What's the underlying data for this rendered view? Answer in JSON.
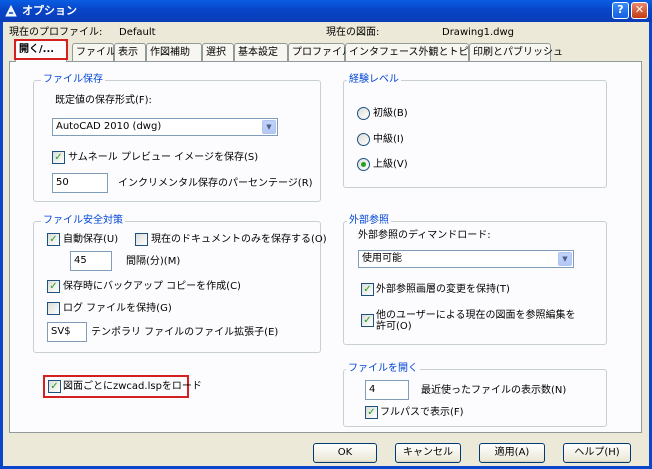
{
  "window": {
    "title": "オプション",
    "help_btn": "?",
    "close_btn": "✕"
  },
  "header": {
    "profile_label": "現在のプロファイル:",
    "profile_value": "Default",
    "drawing_label": "現在の図面:",
    "drawing_value": "Drawing1.dwg"
  },
  "tabs": [
    {
      "label": "開く/..."
    },
    {
      "label": "ファイル"
    },
    {
      "label": "表示"
    },
    {
      "label": "作図補助"
    },
    {
      "label": "選択"
    },
    {
      "label": "基本設定"
    },
    {
      "label": "プロファイル"
    },
    {
      "label": "インタフェース外観とトピック"
    },
    {
      "label": "印刷とパブリッシュ"
    }
  ],
  "file_save": {
    "title": "ファイル保存",
    "format_label": "既定値の保存形式(F):",
    "format_value": "AutoCAD 2010 (dwg)",
    "thumbnail_label": "サムネール プレビュー イメージを保存(S)",
    "thumbnail_checked": true,
    "incremental_value": "50",
    "incremental_label": "インクリメンタル保存のパーセンテージ(R)"
  },
  "file_safety": {
    "title": "ファイル安全対策",
    "autosave_label": "自動保存(U)",
    "autosave_checked": true,
    "current_doc_label": "現在のドキュメントのみを保存する(O)",
    "current_doc_checked": false,
    "interval_value": "45",
    "interval_label": "間隔(分)(M)",
    "backup_label": "保存時にバックアップ コピーを作成(C)",
    "backup_checked": true,
    "log_label": "ログ ファイルを保持(G)",
    "log_checked": false,
    "temp_ext_value": "SV$",
    "temp_ext_label": "テンポラリ ファイルのファイル拡張子(E)"
  },
  "load_lsp": {
    "label": "図面ごとにzwcad.lspをロード",
    "checked": true
  },
  "experience": {
    "title": "経験レベル",
    "options": [
      {
        "label": "初級(B)",
        "selected": false
      },
      {
        "label": "中級(I)",
        "selected": false
      },
      {
        "label": "上級(V)",
        "selected": true
      }
    ]
  },
  "xref": {
    "title": "外部参照",
    "demand_label": "外部参照のディマンドロード:",
    "demand_value": "使用可能",
    "retain_layer_label": "外部参照画層の変更を保持(T)",
    "retain_layer_checked": true,
    "allow_edit_label": "他のユーザーによる現在の図面を参照編集を許可(O)",
    "allow_edit_line1": "他のユーザーによる現在の図面を参照編集を",
    "allow_edit_line2": "許可(O)",
    "allow_edit_checked": true
  },
  "file_open": {
    "title": "ファイルを開く",
    "recent_value": "4",
    "recent_label": "最近使ったファイルの表示数(N)",
    "fullpath_label": "フルパスで表示(F)",
    "fullpath_checked": true
  },
  "buttons": {
    "ok": "OK",
    "cancel": "キャンセル",
    "apply": "適用(A)",
    "help": "ヘルプ(H)"
  },
  "colors": {
    "title_bar": "#0a5ee3",
    "group_title": "#0046d5",
    "highlight": "#d32121",
    "check": "#21a121"
  },
  "icons": {
    "app": "zwcad-app-icon",
    "check": "checkmark-icon",
    "dropdown": "chevron-down-icon"
  }
}
